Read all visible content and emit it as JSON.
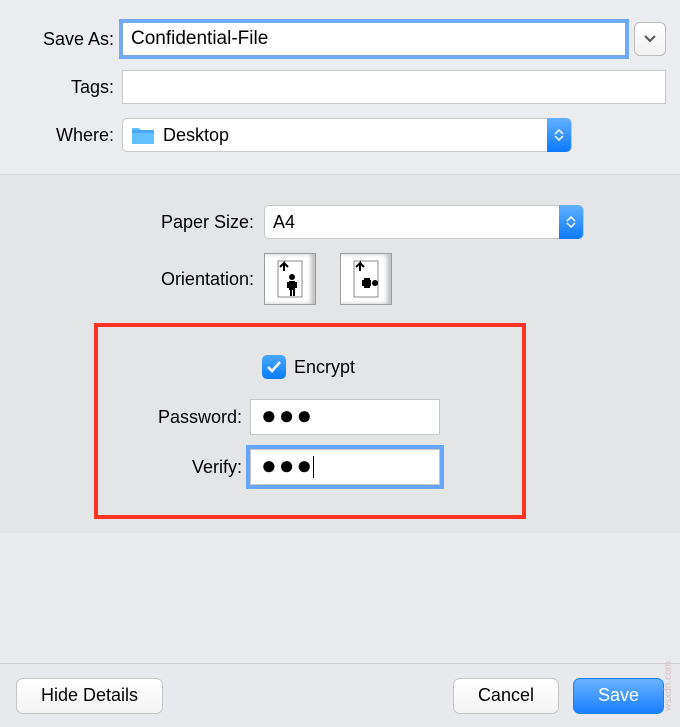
{
  "save_as": {
    "label": "Save As:",
    "value": "Confidential-File"
  },
  "tags": {
    "label": "Tags:",
    "value": ""
  },
  "where": {
    "label": "Where:",
    "value": "Desktop"
  },
  "paper_size": {
    "label": "Paper Size:",
    "value": "A4"
  },
  "orientation": {
    "label": "Orientation:"
  },
  "encrypt": {
    "label": "Encrypt",
    "checked": true
  },
  "password": {
    "label": "Password:",
    "masked": "●●●"
  },
  "verify": {
    "label": "Verify:",
    "masked": "●●●"
  },
  "buttons": {
    "hide_details": "Hide Details",
    "cancel": "Cancel",
    "save": "Save"
  },
  "watermark": "wsxdn.com"
}
